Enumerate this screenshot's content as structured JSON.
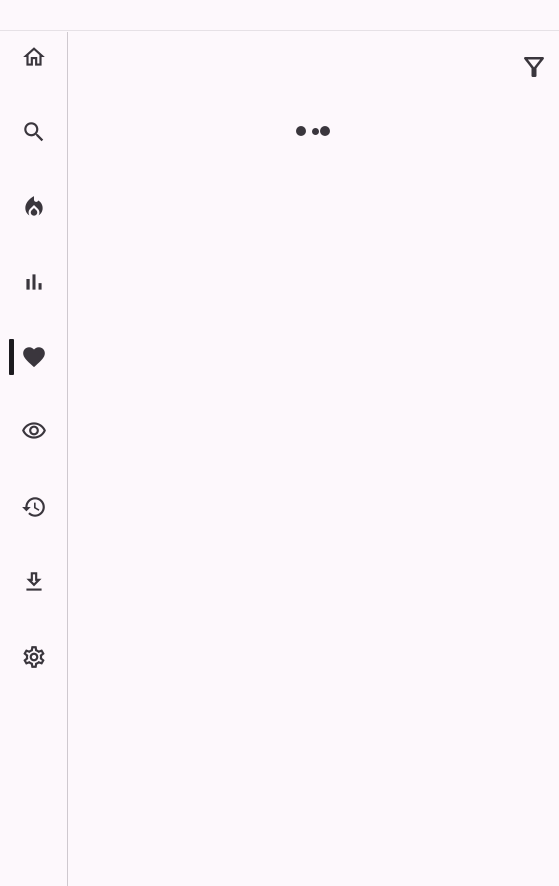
{
  "nav": {
    "items": [
      {
        "id": "home",
        "icon": "home-icon",
        "active": false
      },
      {
        "id": "search",
        "icon": "search-icon",
        "active": false
      },
      {
        "id": "trending",
        "icon": "flame-icon",
        "active": false
      },
      {
        "id": "charts",
        "icon": "bar-chart-icon",
        "active": false
      },
      {
        "id": "favorites",
        "icon": "heart-icon",
        "active": true
      },
      {
        "id": "watching",
        "icon": "eye-icon",
        "active": false
      },
      {
        "id": "history",
        "icon": "history-icon",
        "active": false
      },
      {
        "id": "downloads",
        "icon": "download-icon",
        "active": false
      },
      {
        "id": "settings",
        "icon": "gear-icon",
        "active": false
      }
    ]
  },
  "toolbar": {
    "filter_icon": "filter-icon"
  },
  "loading": {
    "icon": "loading-dots-icon"
  },
  "colors": {
    "background": "#fdf8fc",
    "icon": "#3a363d",
    "active_indicator": "#1c1b1f",
    "divider": "#cfc9cf"
  }
}
